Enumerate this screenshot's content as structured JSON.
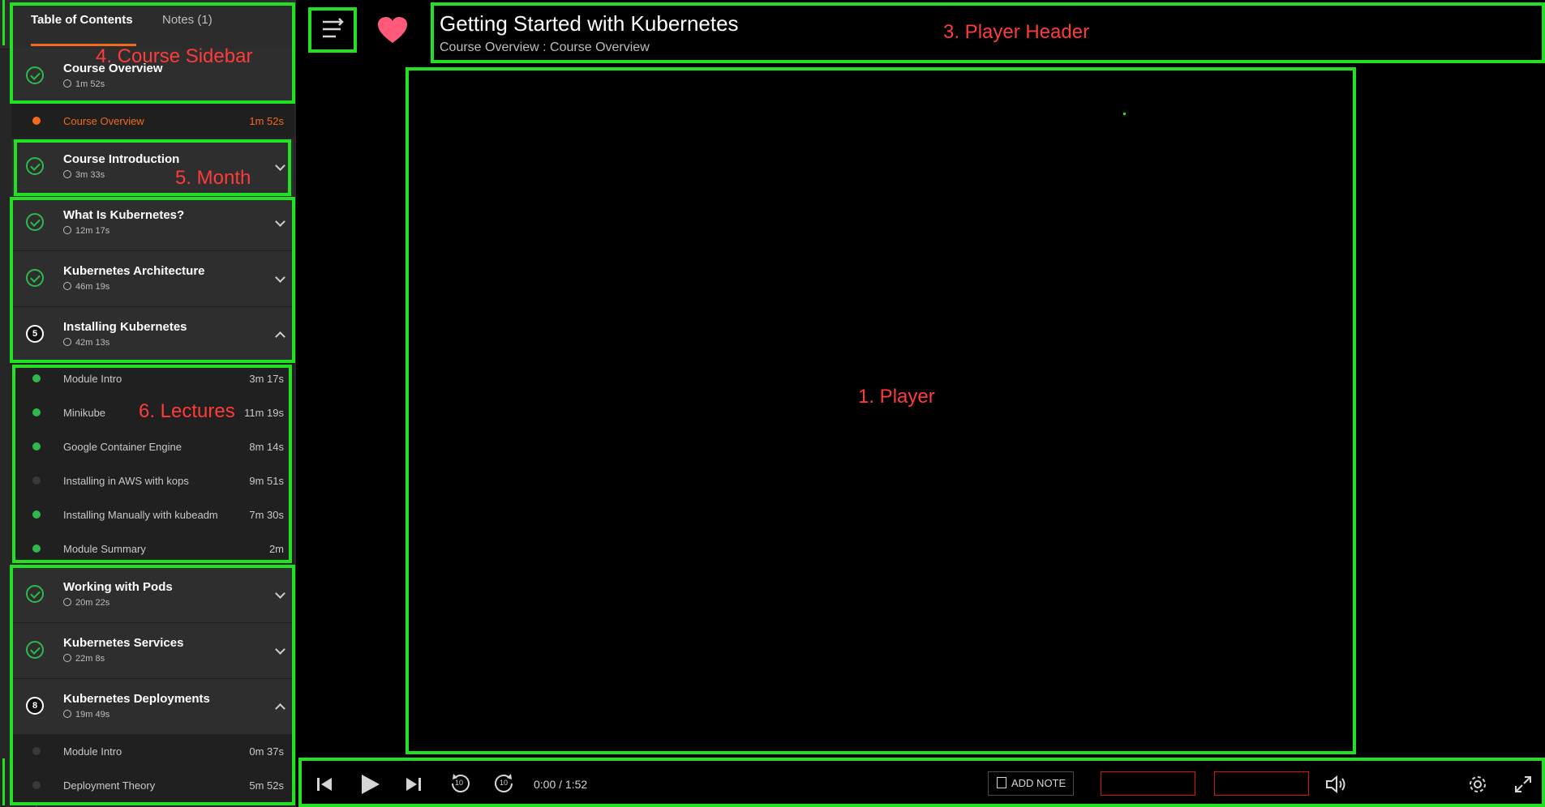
{
  "sidebar": {
    "tab_toc": "Table of Contents",
    "tab_notes": "Notes (1)",
    "modules": [
      {
        "title": "Course Overview",
        "duration": "1m 52s",
        "status": "done"
      },
      {
        "title": "Course Introduction",
        "duration": "3m 33s",
        "status": "done"
      },
      {
        "title": "What Is Kubernetes?",
        "duration": "12m 17s",
        "status": "done"
      },
      {
        "title": "Kubernetes Architecture",
        "duration": "46m 19s",
        "status": "done"
      },
      {
        "title": "Installing Kubernetes",
        "duration": "42m 13s",
        "status": "5"
      },
      {
        "title": "Working with Pods",
        "duration": "20m 22s",
        "status": "done"
      },
      {
        "title": "Kubernetes Services",
        "duration": "22m 8s",
        "status": "done"
      },
      {
        "title": "Kubernetes Deployments",
        "duration": "19m 49s",
        "status": "8"
      }
    ],
    "overview_clip": {
      "title": "Course Overview",
      "duration": "1m 52s"
    },
    "installing_clips": [
      {
        "title": "Module Intro",
        "duration": "3m 17s"
      },
      {
        "title": "Minikube",
        "duration": "11m 19s"
      },
      {
        "title": "Google Container Engine",
        "duration": "8m 14s"
      },
      {
        "title": "Installing in AWS with kops",
        "duration": "9m 51s"
      },
      {
        "title": "Installing Manually with kubeadm",
        "duration": "7m 30s"
      },
      {
        "title": "Module Summary",
        "duration": "2m"
      }
    ],
    "deployments_clips": [
      {
        "title": "Module Intro",
        "duration": "0m 37s"
      },
      {
        "title": "Deployment Theory",
        "duration": "5m 52s"
      }
    ]
  },
  "header": {
    "title": "Getting Started with Kubernetes",
    "subtitle": "Course Overview : Course Overview"
  },
  "controls": {
    "time": "0:00 / 1:52",
    "add_note": "ADD NOTE",
    "skip_back_label": "10",
    "skip_fwd_label": "10"
  },
  "annotations": {
    "player": "1. Player",
    "header": "3. Player Header",
    "sidebar": "4. Course Sidebar",
    "month": "5. Month",
    "lectures": "6. Lectures"
  },
  "colors": {
    "accent": "#f26b1d",
    "done": "#2fb84c",
    "annotation_box": "#22e022",
    "annotation_text": "#ff3b3b",
    "heart": "#ff5a7a"
  }
}
